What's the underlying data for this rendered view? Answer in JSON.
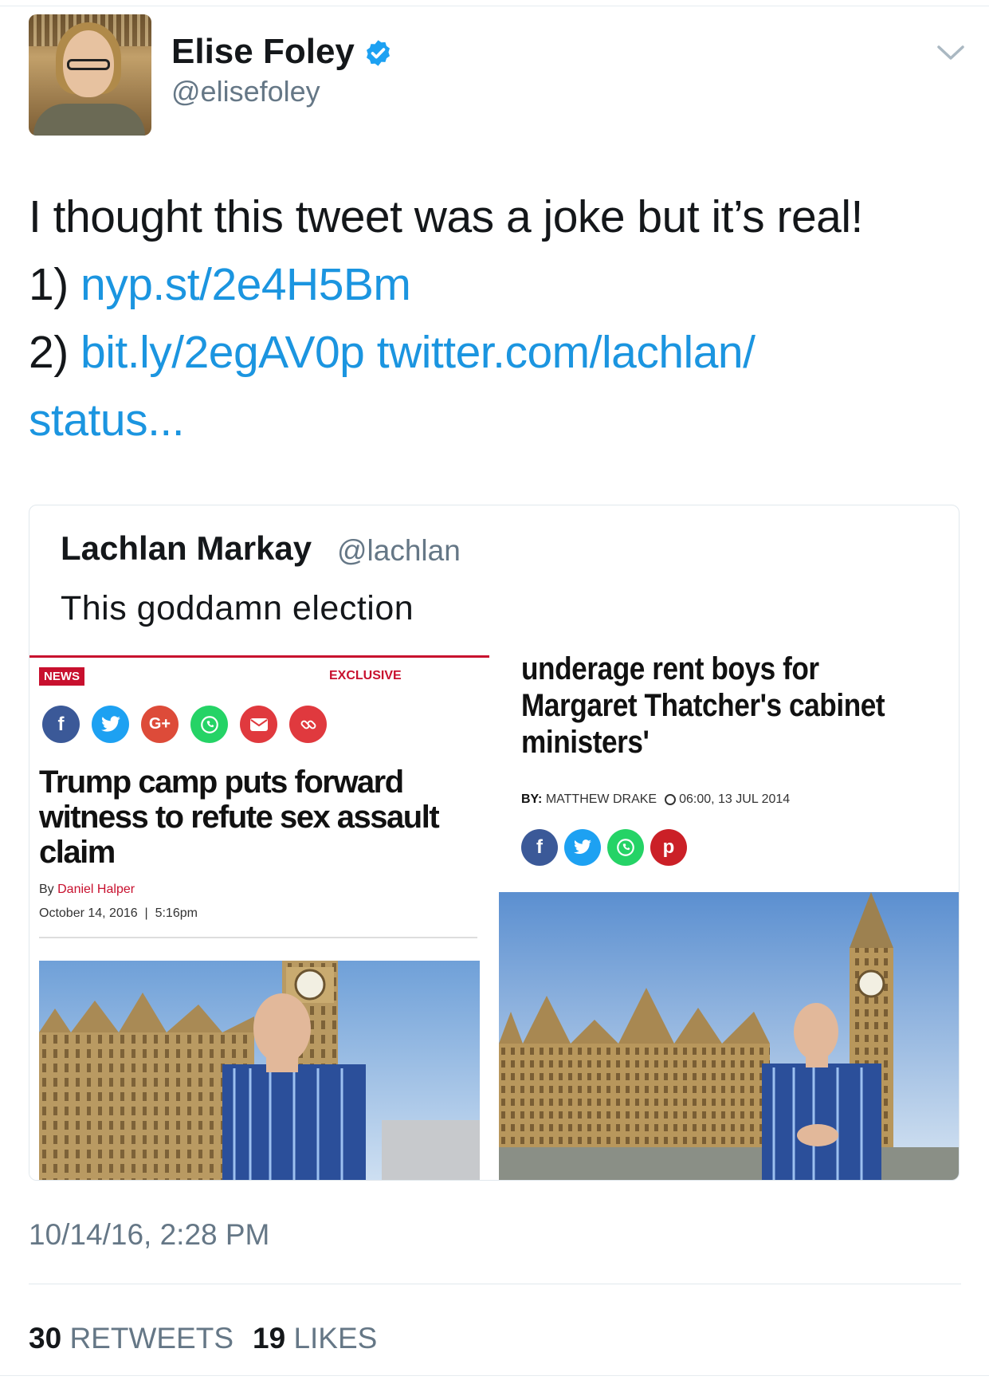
{
  "author": {
    "name": "Elise Foley",
    "handle": "@elisefoley"
  },
  "tweet": {
    "line1": "I thought this tweet was a joke but it’s real!",
    "item1_prefix": "1) ",
    "item1_link": "nyp.st/2e4H5Bm",
    "item2_prefix": "2) ",
    "item2_link1": "bit.ly/2egAV0p",
    "item2_link2": "twitter.com/lachlan/",
    "item2_link2_cont": "status..."
  },
  "quoted": {
    "name": "Lachlan Markay",
    "handle": "@lachlan",
    "text": "This goddamn election",
    "article_left": {
      "badge": "NEWS",
      "tag": "EXCLUSIVE",
      "share_icons": [
        "f",
        "t",
        "G+",
        "w",
        "✉",
        "🔗"
      ],
      "headline": "Trump camp puts forward witness to refute sex assault claim",
      "by_prefix": "By ",
      "author": "Daniel Halper",
      "date": "October 14, 2016",
      "time": "5:16pm"
    },
    "article_right": {
      "headline": "underage rent boys for Margaret Thatcher's cabinet ministers'",
      "by_label": "BY:",
      "author": "MATTHEW DRAKE",
      "datetime": "06:00, 13 JUL 2014",
      "share_icons": [
        "f",
        "t",
        "w",
        "p"
      ]
    }
  },
  "timestamp": "10/14/16, 2:28 PM",
  "stats": {
    "retweets_count": "30",
    "retweets_label": "RETWEETS",
    "likes_count": "19",
    "likes_label": "LIKES"
  },
  "colors": {
    "link": "#1b95e0",
    "muted": "#657786",
    "verified": "#1da1f2",
    "news_red": "#c8102e"
  }
}
